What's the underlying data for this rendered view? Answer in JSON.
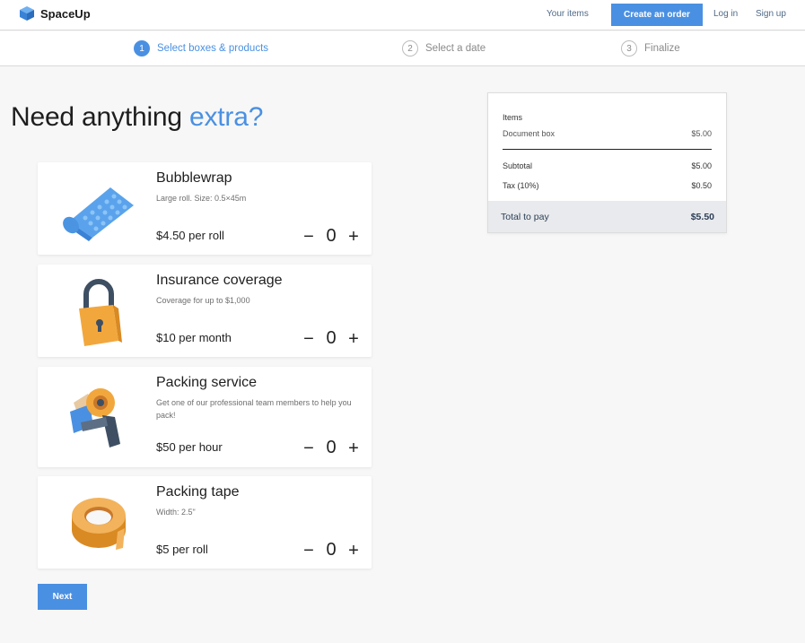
{
  "header": {
    "brand": "SpaceUp",
    "your_items": "Your items",
    "create_order": "Create an order",
    "login": "Log in",
    "signup": "Sign up"
  },
  "steps": [
    {
      "num": "1",
      "label": "Select boxes & products",
      "active": true
    },
    {
      "num": "2",
      "label": "Select a date",
      "active": false
    },
    {
      "num": "3",
      "label": "Finalize",
      "active": false
    }
  ],
  "heading": {
    "prefix": "Need anything ",
    "accent": "extra?"
  },
  "products": [
    {
      "title": "Bubblewrap",
      "desc": "Large roll. Size: 0.5×45m",
      "price": "$4.50 per roll",
      "qty": "0",
      "icon": "bubblewrap-icon"
    },
    {
      "title": "Insurance coverage",
      "desc": "Coverage for up to $1,000",
      "price": "$10 per month",
      "qty": "0",
      "icon": "padlock-icon"
    },
    {
      "title": "Packing service",
      "desc": "Get one of our professional team members to help you pack!",
      "price": "$50 per hour",
      "qty": "0",
      "icon": "tape-dispenser-icon"
    },
    {
      "title": "Packing tape",
      "desc": "Width: 2.5\"",
      "price": "$5 per roll",
      "qty": "0",
      "icon": "tape-roll-icon"
    }
  ],
  "qty_controls": {
    "minus": "−",
    "plus": "+"
  },
  "next_button": "Next",
  "summary": {
    "items_label": "Items",
    "lines": [
      {
        "label": "Document box",
        "amount": "$5.00"
      }
    ],
    "subtotal_label": "Subtotal",
    "subtotal": "$5.00",
    "tax_label": "Tax (10%)",
    "tax": "$0.50",
    "total_label": "Total to pay",
    "total": "$5.50"
  },
  "colors": {
    "accent": "#4a90e2",
    "background": "#f7f7f7",
    "total_bg": "#e8eaed"
  }
}
